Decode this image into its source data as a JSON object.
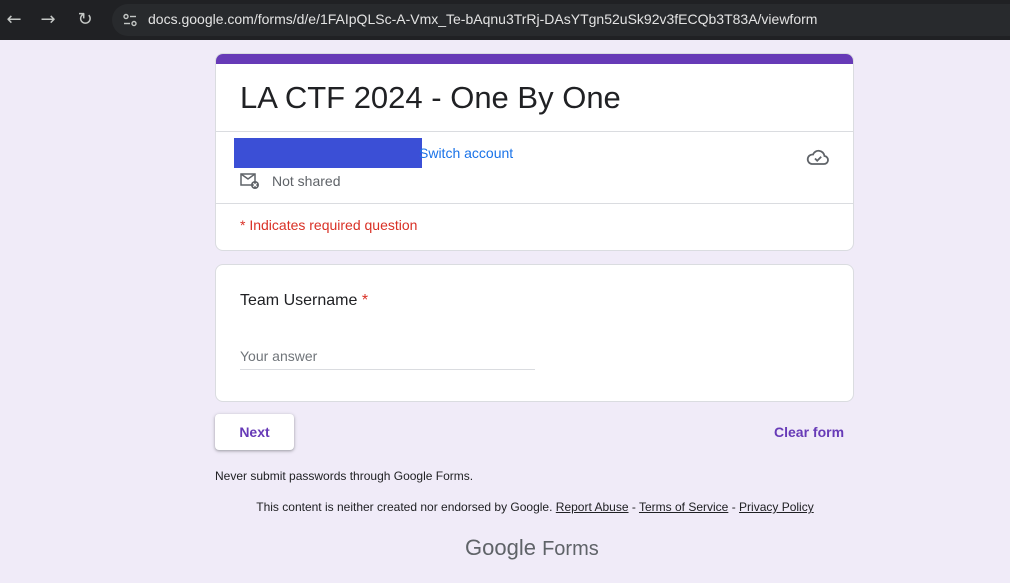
{
  "browser": {
    "url": "docs.google.com/forms/d/e/1FAIpQLSc-A-Vmx_Te-bAqnu3TrRj-DAsYTgn52uSk92v3fECQb3T83A/viewform",
    "back_icon": "arrow-left",
    "forward_icon": "arrow-right",
    "reload_icon": "reload"
  },
  "form": {
    "title": "LA CTF 2024 - One By One",
    "accent_color": "#673ab7",
    "switch_account": "Switch account",
    "not_shared": "Not shared",
    "required_note": "* Indicates required question"
  },
  "question": {
    "label": "Team Username",
    "required_marker": "*",
    "placeholder": "Your answer"
  },
  "actions": {
    "next": "Next",
    "clear_form": "Clear form"
  },
  "footer": {
    "never_submit": "Never submit passwords through Google Forms.",
    "disclaimer": "This content is neither created nor endorsed by Google.",
    "report_abuse": "Report Abuse",
    "sep1": "-",
    "terms": "Terms of Service",
    "sep2": "-",
    "privacy": "Privacy Policy",
    "brand_google": "Google",
    "brand_forms": "Forms"
  }
}
